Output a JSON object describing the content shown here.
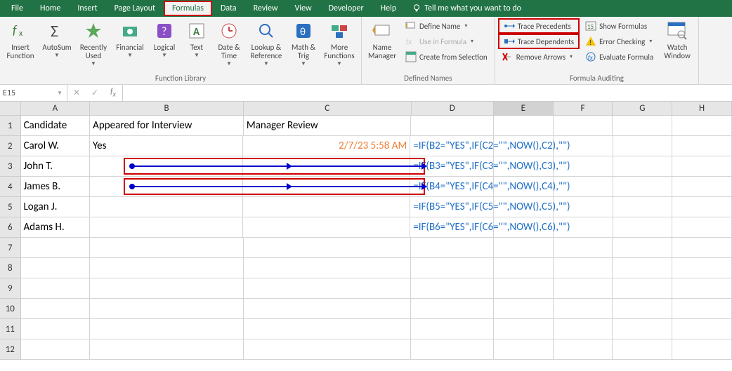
{
  "menu": {
    "items": [
      "File",
      "Home",
      "Insert",
      "Page Layout",
      "Formulas",
      "Data",
      "Review",
      "View",
      "Developer",
      "Help"
    ],
    "active": "Formulas",
    "tell_me": "Tell me what you want to do"
  },
  "ribbon": {
    "function_library": {
      "title": "Function Library",
      "insert_function": "Insert\nFunction",
      "autosum": "AutoSum",
      "recently_used": "Recently\nUsed",
      "financial": "Financial",
      "logical": "Logical",
      "text": "Text",
      "date_time": "Date &\nTime",
      "lookup_ref": "Lookup &\nReference",
      "math_trig": "Math &\nTrig",
      "more_functions": "More\nFunctions"
    },
    "defined_names": {
      "title": "Defined Names",
      "name_manager": "Name\nManager",
      "define_name": "Define Name",
      "use_in_formula": "Use in Formula",
      "create_from_selection": "Create from Selection"
    },
    "formula_auditing": {
      "title": "Formula Auditing",
      "trace_precedents": "Trace Precedents",
      "trace_dependents": "Trace Dependents",
      "remove_arrows": "Remove Arrows",
      "show_formulas": "Show Formulas",
      "error_checking": "Error Checking",
      "evaluate_formula": "Evaluate Formula",
      "watch_window": "Watch\nWindow"
    }
  },
  "formula_bar": {
    "name_box": "E15",
    "formula": ""
  },
  "columns": [
    "A",
    "B",
    "C",
    "D",
    "E",
    "F",
    "G",
    "H"
  ],
  "rows": [
    "1",
    "2",
    "3",
    "4",
    "5",
    "6",
    "7",
    "8",
    "9",
    "10",
    "11",
    "12"
  ],
  "selected_cell": "E15",
  "headers_row": {
    "A": "Candidate",
    "B": "Appeared for Interview",
    "C": "Manager Review"
  },
  "data_rows": [
    {
      "A": "Carol W.",
      "B": "Yes",
      "C": "2/7/23 5:58 AM",
      "D": "=IF(B2=\"YES\",IF(C2=\"\",NOW(),C2),\"\")"
    },
    {
      "A": "John T.",
      "B": "",
      "C": "",
      "D": "=IF(B3=\"YES\",IF(C3=\"\",NOW(),C3),\"\")"
    },
    {
      "A": "James B.",
      "B": "",
      "C": "",
      "D": "=IF(B4=\"YES\",IF(C4=\"\",NOW(),C4),\"\")"
    },
    {
      "A": "Logan J.",
      "B": "",
      "C": "",
      "D": "=IF(B5=\"YES\",IF(C5=\"\",NOW(),C5),\"\")"
    },
    {
      "A": "Adams H.",
      "B": "",
      "C": "",
      "D": "=IF(B6=\"YES\",IF(C6=\"\",NOW(),C6),\"\")"
    }
  ],
  "highlights": {
    "formulas_tab": true,
    "trace_precedents": true,
    "trace_dependents": true,
    "row3_arrow": true,
    "row4_arrow": true
  }
}
